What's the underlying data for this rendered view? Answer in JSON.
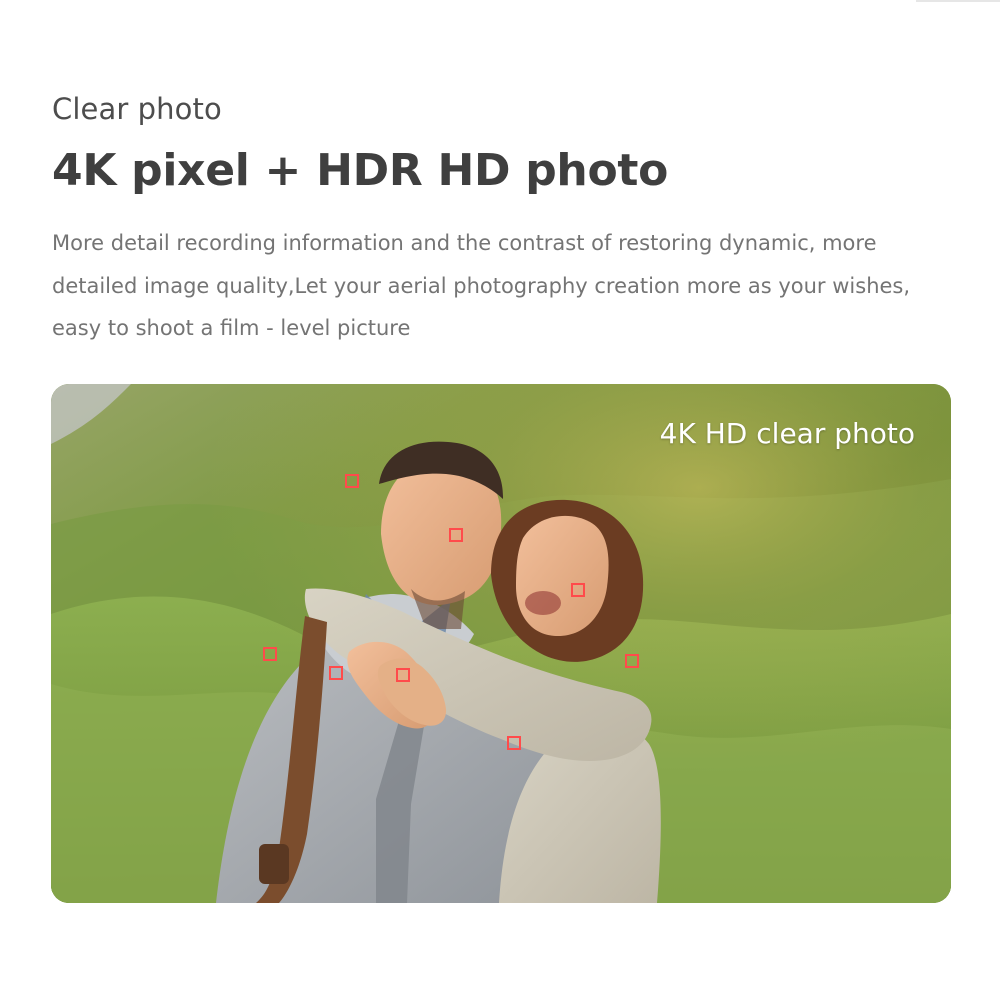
{
  "content": {
    "subtitle": "Clear photo",
    "headline": "4K pixel + HDR HD photo",
    "description_lines": [
      "More detail recording information and the  contrast of restoring dynamic, more",
      "detailed image quality,Let your aerial photography creation more as your wishes,",
      "easy to shoot a film - level picture"
    ]
  },
  "photo": {
    "caption": "4K HD clear photo",
    "focus_color": "#ff4b4b"
  }
}
